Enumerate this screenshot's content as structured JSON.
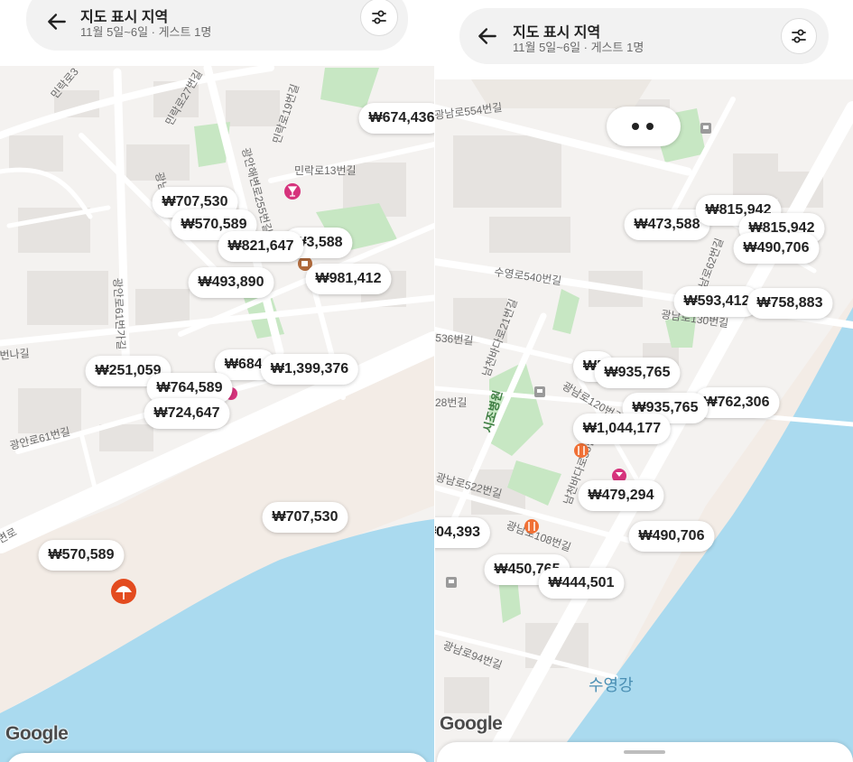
{
  "header": {
    "title": "지도 표시 지역",
    "subtitle": "11월 5일~6일 · 게스트 1명",
    "back_icon": "arrow-left-icon",
    "filter_icon": "sliders-icon"
  },
  "attribution": "Google",
  "colors": {
    "water": "#aadaef",
    "land": "#f4f2f0",
    "park": "#c5e8c2",
    "building": "#e4e1de",
    "road": "#ffffff"
  },
  "left_map": {
    "price_pins": [
      "₩674,436",
      "₩707,530",
      "₩570,589",
      "₩821,647",
      "₩3,588",
      "₩981,412",
      "₩493,890",
      "₩684,",
      "₩1,399,376",
      "₩251,059",
      "₩764,589",
      "₩724,647",
      "₩707,530",
      "₩570,589"
    ],
    "street_labels": [
      "민락로3",
      "민락로27번길",
      "민락로19번길",
      "광남로",
      "광안해변로255번길",
      "민락로13번길",
      "광안로61번가길",
      "번나길",
      "광안로61번길",
      "변로"
    ]
  },
  "right_map": {
    "price_pins": [
      "₩473,588",
      "₩815,942",
      "₩815,942",
      "₩490,706",
      "₩593,412",
      "₩758,883",
      "₩5",
      "₩935,765",
      "₩935,765",
      "₩762,306",
      "₩1,044,177",
      "₩479,294",
      "₩490,706",
      "₩04,393",
      "₩450,765",
      "₩444,501"
    ],
    "street_labels": [
      "광남로554번길",
      "수영로540번길",
      "광남로130번길",
      "536번길",
      "남천바다로21번길",
      "광남로120번길",
      "28번길",
      "광남로522번길",
      "남천바다로35번길",
      "광남로108번길",
      "광남로94번길",
      "광남로62번길"
    ],
    "park_label": "시조병원",
    "river_label": "수영강"
  }
}
